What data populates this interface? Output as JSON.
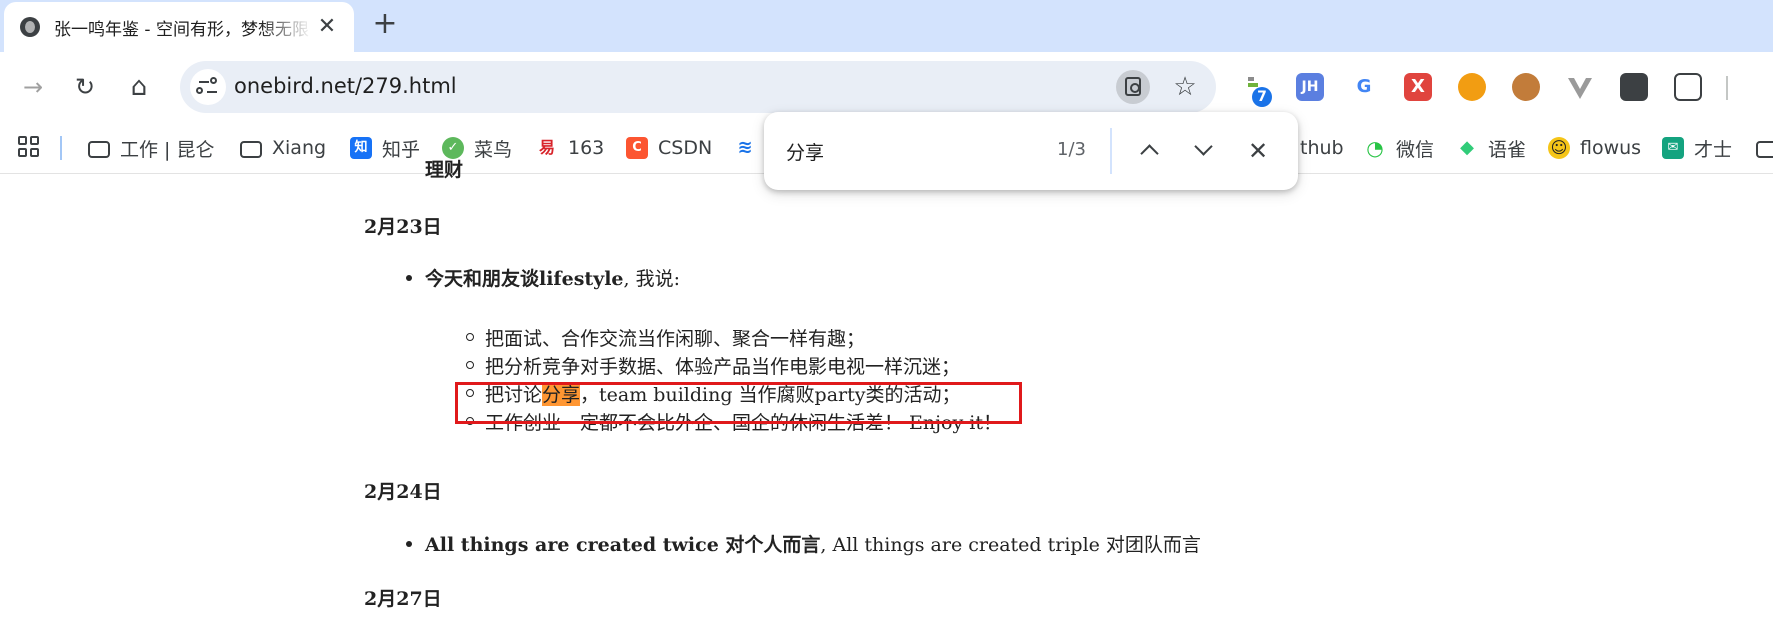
{
  "tab": {
    "title": "张一鸣年鉴 - 空间有形，梦想无限",
    "close": "✕"
  },
  "new_tab": "+",
  "toolbar": {
    "back": "→",
    "reload": "↻",
    "home": "⌂",
    "url": "onebird.net/279.html",
    "star": "☆"
  },
  "extensions": [
    {
      "icon": "tampermonkey-icon",
      "badge": "7",
      "color": "#3c6fd8"
    },
    {
      "icon": "jh-icon",
      "label": "JH",
      "color": "#5b7fe0"
    },
    {
      "icon": "translate-icon",
      "label": "G",
      "color": "#4285f4"
    },
    {
      "icon": "x-icon",
      "label": "X",
      "color": "#e0443e"
    },
    {
      "icon": "clock-icon",
      "label": "",
      "color": "#f29d12"
    },
    {
      "icon": "cookie-icon",
      "label": "",
      "color": "#b5651d"
    },
    {
      "icon": "vue-icon",
      "label": "",
      "color": "#888888"
    },
    {
      "icon": "incognito-icon",
      "label": "",
      "color": "#3c4043"
    },
    {
      "icon": "puzzle-icon",
      "label": "",
      "color": "#3c4043"
    }
  ],
  "bookmarks": [
    {
      "label": "工作 | 昆仑",
      "icon": "folder-icon"
    },
    {
      "label": "Xiang",
      "icon": "folder-icon"
    },
    {
      "label": "知乎",
      "icon": "zhihu-icon",
      "glyph": "知",
      "color": "#1772f6"
    },
    {
      "label": "菜鸟",
      "icon": "runoob-icon",
      "glyph": "✓",
      "color": "#5db85c"
    },
    {
      "label": "163",
      "icon": "netease-icon",
      "glyph": "易",
      "color": "#d8232a"
    },
    {
      "label": "CSDN",
      "icon": "csdn-icon",
      "glyph": "C",
      "color": "#fc5531"
    },
    {
      "label": "thub",
      "icon": "github-icon"
    },
    {
      "label": "微信",
      "icon": "wechat-icon",
      "glyph": "◔",
      "color": "#28c445"
    },
    {
      "label": "语雀",
      "icon": "yuque-icon",
      "glyph": "◆",
      "color": "#31cc79"
    },
    {
      "label": "flowus",
      "icon": "flowus-icon",
      "glyph": "☺",
      "color": "#f5c518"
    },
    {
      "label": "才士",
      "icon": "caishi-icon",
      "glyph": "✉",
      "color": "#14a37f"
    }
  ],
  "find": {
    "query": "分享",
    "count": "1/3",
    "close": "✕"
  },
  "content": {
    "top_partial": "理财",
    "sections": [
      {
        "date": "2月23日",
        "bullet_bold": "今天和朋友谈lifestyle",
        "bullet_rest": ", 我说:",
        "sub_items": [
          "把面试、合作交流当作闲聊、聚合一样有趣；",
          "把分析竞争对手数据、体验产品当作电影电视一样沉迷；",
          {
            "before": "把讨论",
            "match": "分享",
            "after": "，team building 当作腐败party类的活动；"
          },
          "工作创业一定都不会比外企、国企的休闲生活差！ Enjoy it！"
        ]
      },
      {
        "date": "2月24日",
        "bullet_bold": "All things are created twice 对个人而言",
        "bullet_rest": ", All things are created triple 对团队而言"
      },
      {
        "date": "2月27日"
      }
    ]
  },
  "colors": {
    "highlight": "#ff9632",
    "annotation": "#e0191b",
    "tabstrip": "#d3e3fd"
  }
}
